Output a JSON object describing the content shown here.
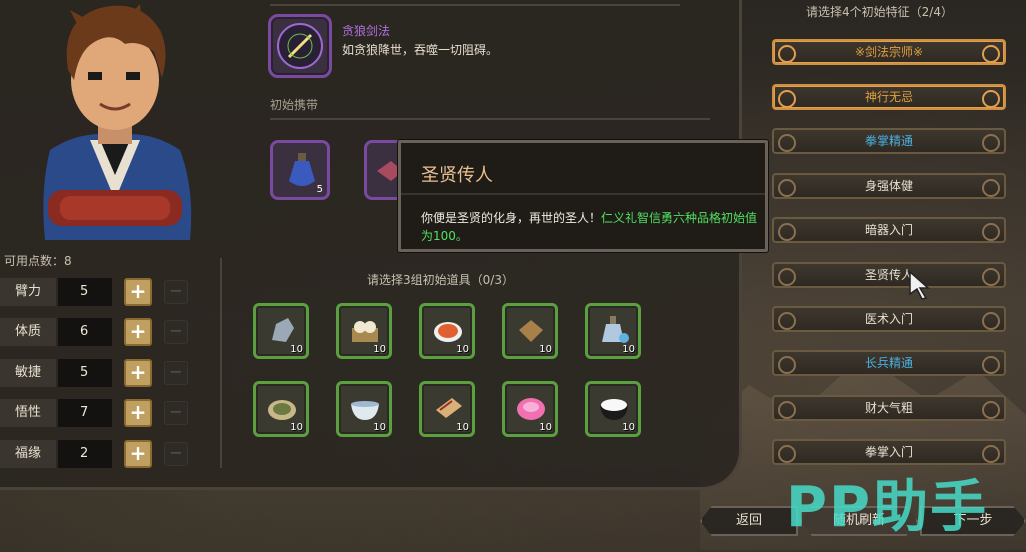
{
  "skill": {
    "name": "贪狼剑法",
    "desc": "如贪狼降世，吞噬一切阻碍。"
  },
  "carry": {
    "label": "初始携带",
    "items": [
      {
        "icon": "potion-bottle-icon",
        "count": "5"
      },
      {
        "icon": "scroll-icon",
        "count": ""
      }
    ]
  },
  "tooltip": {
    "title": "圣贤传人",
    "body_plain": "你便是圣贤的化身，再世的圣人！",
    "body_green": "仁义礼智信勇六种品格初始值为100。"
  },
  "attributes": {
    "points_label": "可用点数：8",
    "rows": [
      {
        "name": "臂力",
        "value": "5"
      },
      {
        "name": "体质",
        "value": "6"
      },
      {
        "name": "敏捷",
        "value": "5"
      },
      {
        "name": "悟性",
        "value": "7"
      },
      {
        "name": "福缘",
        "value": "2"
      }
    ],
    "plus": "+",
    "minus": "−"
  },
  "items": {
    "label": "请选择3组初始道具（0/3）",
    "grid": [
      {
        "icon": "stone-icon",
        "count": "10"
      },
      {
        "icon": "steamed-buns-icon",
        "count": "10"
      },
      {
        "icon": "dumplings-plate-icon",
        "count": "10"
      },
      {
        "icon": "cloth-package-icon",
        "count": "10"
      },
      {
        "icon": "wine-bottle-icon",
        "count": "10"
      },
      {
        "icon": "tea-plate-icon",
        "count": "10"
      },
      {
        "icon": "bowl-icon",
        "count": "10"
      },
      {
        "icon": "book-icon",
        "count": "10"
      },
      {
        "icon": "pink-cake-icon",
        "count": "10"
      },
      {
        "icon": "rice-bowl-icon",
        "count": "10"
      }
    ]
  },
  "traits": {
    "title": "请选择4个初始特征（2/4）",
    "list": [
      {
        "label": "※剑法宗师※",
        "color": "#e0a040",
        "selected": true
      },
      {
        "label": "神行无忌",
        "color": "#e0a040",
        "selected": true
      },
      {
        "label": "拳掌精通",
        "color": "#4ab0e0",
        "selected": false
      },
      {
        "label": "身强体健",
        "color": "#e8e0d0",
        "selected": false
      },
      {
        "label": "暗器入门",
        "color": "#e8e0d0",
        "selected": false
      },
      {
        "label": "圣贤传人",
        "color": "#e8e0d0",
        "selected": false
      },
      {
        "label": "医术入门",
        "color": "#e8e0d0",
        "selected": false
      },
      {
        "label": "长兵精通",
        "color": "#4ab0e0",
        "selected": false
      },
      {
        "label": "财大气粗",
        "color": "#e8e0d0",
        "selected": false
      },
      {
        "label": "拳掌入门",
        "color": "#e8e0d0",
        "selected": false
      }
    ]
  },
  "nav": {
    "back": "返回",
    "random": "随机刷新",
    "next": "下一步"
  },
  "watermark": "PP助手"
}
